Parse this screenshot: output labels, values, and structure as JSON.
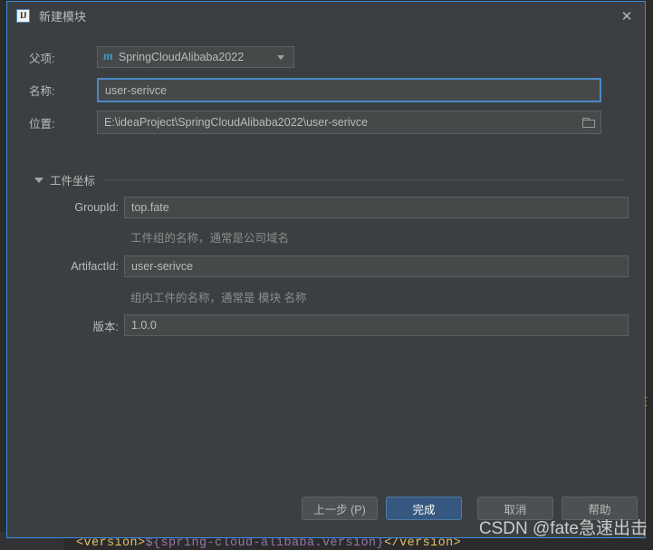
{
  "background": {
    "code_line_prefix": "<version>",
    "code_line_prop": "${spring-cloud-alibaba.version}",
    "code_line_suffix": "</version>",
    "right_ghost_char": "在"
  },
  "dialog": {
    "title": "新建模块",
    "app_icon": "intellij-idea-icon",
    "app_icon_text": "IJ",
    "close_icon": "✕",
    "fields": {
      "parent": {
        "label": "父项:",
        "value": "SpringCloudAlibaba2022",
        "icon": "maven-module-icon",
        "icon_text": "m"
      },
      "name": {
        "label": "名称:",
        "value": "user-serivce",
        "focused": true
      },
      "location": {
        "label": "位置:",
        "value": "E:\\ideaProject\\SpringCloudAlibaba2022\\user-serivce",
        "browse_icon": "folder-icon"
      }
    },
    "artifact_group": {
      "title": "工件坐标",
      "expanded": true,
      "expander_icon": "chevron-down-icon",
      "group_id": {
        "label": "GroupId:",
        "value": "top.fate",
        "hint": "工件组的名称，通常是公司域名"
      },
      "artifact_id": {
        "label": "ArtifactId:",
        "value": "user-serivce",
        "hint": "组内工件的名称，通常是 模块 名称"
      },
      "version": {
        "label": "版本:",
        "value": "1.0.0"
      }
    },
    "buttons": {
      "previous": "上一步 (P)",
      "finish": "完成",
      "cancel": "取消",
      "help": "帮助"
    }
  },
  "watermark": {
    "text": "CSDN @fate急速出击"
  },
  "colors": {
    "dialog_bg": "#3c3f41",
    "dialog_border": "#3b8ae6",
    "field_bg": "#45494a",
    "primary_button": "#365880",
    "accent": "#4a88c7",
    "text": "#bbbbbb",
    "hint_text": "#8c8c8c"
  }
}
